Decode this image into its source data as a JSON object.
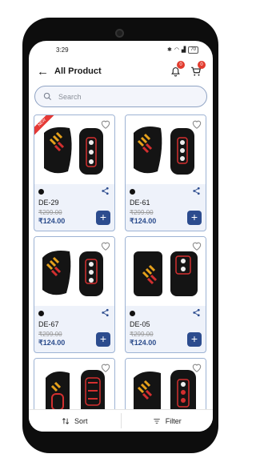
{
  "status_bar": {
    "time": "3:29",
    "battery": "70"
  },
  "header": {
    "title": "All Product",
    "notification_count": "0",
    "cart_count": "0"
  },
  "search": {
    "placeholder": "Search"
  },
  "products": [
    {
      "code": "DE-29",
      "mrp": "₹299.00",
      "price": "₹124.00",
      "badge": "NEW"
    },
    {
      "code": "DE-61",
      "mrp": "₹299.00",
      "price": "₹124.00"
    },
    {
      "code": "DE-67",
      "mrp": "₹299.00",
      "price": "₹124.00"
    },
    {
      "code": "DE-05",
      "mrp": "₹299.00",
      "price": "₹124.00"
    },
    {
      "code": "",
      "mrp": "",
      "price": ""
    },
    {
      "code": "",
      "mrp": "",
      "price": ""
    }
  ],
  "bottom_bar": {
    "sort_label": "Sort",
    "filter_label": "Filter"
  },
  "colors": {
    "accent": "#2c4c8e",
    "badge": "#e23b2e",
    "card_bg": "#eef2fa",
    "card_border": "#9db3d4"
  }
}
